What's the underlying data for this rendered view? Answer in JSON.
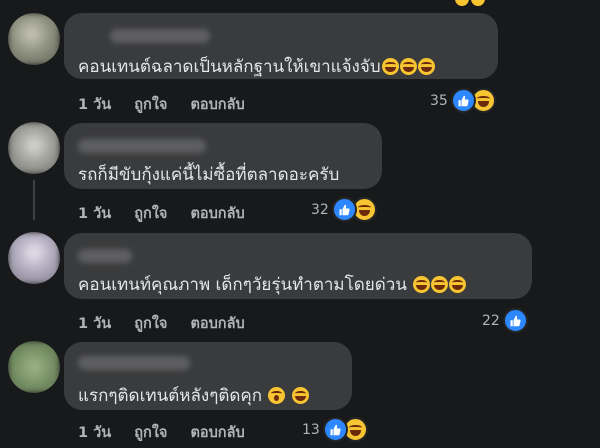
{
  "comments": [
    {
      "text": "คอนเทนต์ฉลาดเป็นหลักฐานให้เขาแจ้งจับ",
      "emojis": [
        "rofl-emoji",
        "rofl-emoji",
        "rofl-emoji"
      ],
      "time": "1 วัน",
      "like": "ถูกใจ",
      "reply": "ตอบกลับ",
      "reaction_count": "35",
      "reactions": [
        "like",
        "haha"
      ]
    },
    {
      "text": "รถก็มีขับกุ้งแค่นี้ไม่ซื้อที่ตลาดอะครับ",
      "emojis": [],
      "time": "1 วัน",
      "like": "ถูกใจ",
      "reply": "ตอบกลับ",
      "reaction_count": "32",
      "reactions": [
        "like",
        "haha"
      ]
    },
    {
      "text": "คอนเทนท์คุณภาพ เด็กๆวัยรุ่นทำตามโดยด่วน",
      "emojis": [
        "rofl-emoji",
        "rofl-emoji",
        "rofl-emoji"
      ],
      "time": "1 วัน",
      "like": "ถูกใจ",
      "reply": "ตอบกลับ",
      "reaction_count": "22",
      "reactions": [
        "like"
      ]
    },
    {
      "text": "แรกๆติดเทนต์หลังๆติดคุก",
      "emojis": [
        "screaming-face-emoji",
        "sweat-smile-emoji"
      ],
      "time": "1 วัน",
      "like": "ถูกใจ",
      "reply": "ตอบกลับ",
      "reaction_count": "13",
      "reactions": [
        "like",
        "haha"
      ]
    }
  ],
  "colors": {
    "background": "#18191a",
    "bubble": "#3a3b3c",
    "text": "#e4e6eb",
    "secondary_text": "#b0b3b8",
    "like_blue": "#2d88ff",
    "haha_yellow": "#f7c531"
  }
}
